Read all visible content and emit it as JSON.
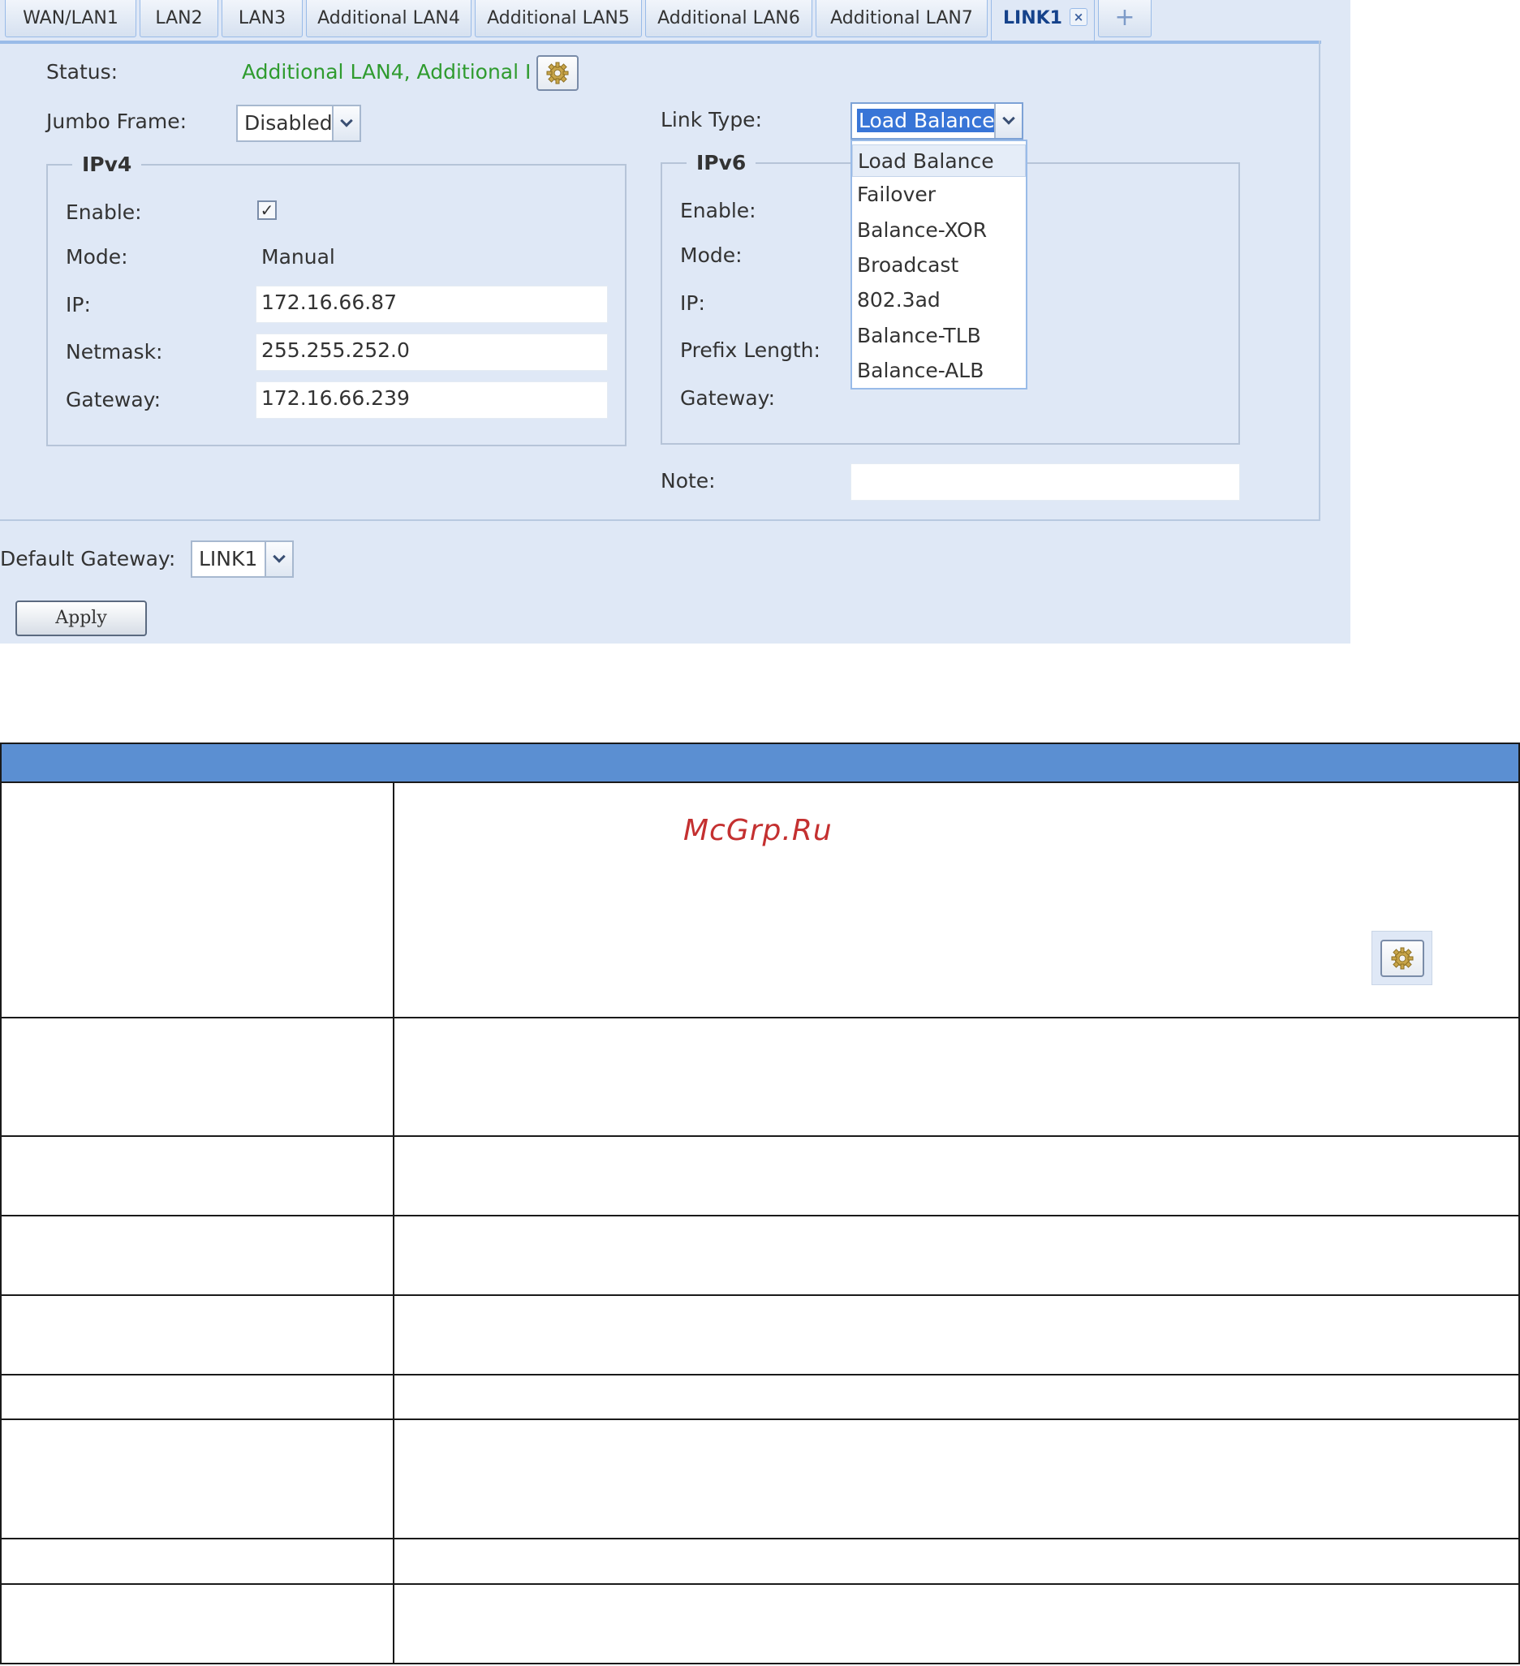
{
  "tabs": [
    {
      "label": "WAN/LAN1",
      "active": false
    },
    {
      "label": "LAN2",
      "active": false
    },
    {
      "label": "LAN3",
      "active": false
    },
    {
      "label": "Additional LAN4",
      "active": false
    },
    {
      "label": "Additional LAN5",
      "active": false
    },
    {
      "label": "Additional LAN6",
      "active": false
    },
    {
      "label": "Additional LAN7",
      "active": false
    },
    {
      "label": "LINK1",
      "active": true,
      "close_glyph": "×"
    }
  ],
  "add_tab_glyph": "+",
  "status": {
    "label": "Status:",
    "value": "Additional LAN4, Additional I",
    "color": "#2f9b2f",
    "config_icon": "gear-icon"
  },
  "jumbo_frame": {
    "label": "Jumbo Frame:",
    "value": "Disabled"
  },
  "link_type": {
    "label": "Link Type:",
    "value": "Load Balance",
    "options": [
      "Load Balance",
      "Failover",
      "Balance-XOR",
      "Broadcast",
      "802.3ad",
      "Balance-TLB",
      "Balance-ALB"
    ],
    "highlighted": "Load Balance"
  },
  "ipv4": {
    "legend": "IPv4",
    "enable_label": "Enable:",
    "enabled": true,
    "check_glyph": "✓",
    "mode_label": "Mode:",
    "mode_value": "Manual",
    "ip_label": "IP:",
    "ip_value": "172.16.66.87",
    "netmask_label": "Netmask:",
    "netmask_value": "255.255.252.0",
    "gateway_label": "Gateway:",
    "gateway_value": "172.16.66.239"
  },
  "ipv6": {
    "legend": "IPv6",
    "enable_label": "Enable:",
    "mode_label": "Mode:",
    "ip_label": "IP:",
    "prefix_label": "Prefix Length:",
    "gateway_label": "Gateway:"
  },
  "note": {
    "label": "Note:",
    "value": ""
  },
  "default_gateway": {
    "label": "Default Gateway:",
    "value": "LINK1"
  },
  "apply_label": "Apply",
  "watermark": "McGrp.Ru",
  "colors": {
    "panel_bg": "#dfe8f6",
    "table_header": "#5b8fd2",
    "tab_border": "#99bbe8",
    "selection": "#3875d7",
    "watermark": "#c43030"
  }
}
